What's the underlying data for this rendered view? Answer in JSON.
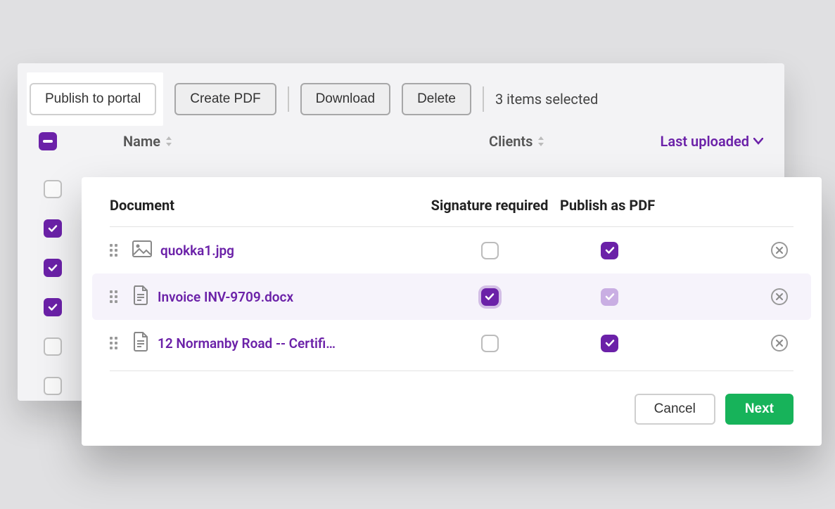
{
  "toolbar": {
    "publish_label": "Publish to portal",
    "create_pdf_label": "Create PDF",
    "download_label": "Download",
    "delete_label": "Delete",
    "selected_text": "3 items selected"
  },
  "headers": {
    "name": "Name",
    "clients": "Clients",
    "last_uploaded": "Last uploaded"
  },
  "bg_rows": [
    {
      "checked": false
    },
    {
      "checked": true
    },
    {
      "checked": true
    },
    {
      "checked": true
    },
    {
      "checked": false
    },
    {
      "checked": false
    }
  ],
  "dialog": {
    "col_document": "Document",
    "col_signature": "Signature required",
    "col_publish_pdf": "Publish as PDF",
    "rows": [
      {
        "name": "quokka1.jpg",
        "type": "image",
        "sig": false,
        "pdf": true,
        "active": false
      },
      {
        "name": "Invoice INV-9709.docx",
        "type": "doc",
        "sig": true,
        "pdf": "disabled",
        "active": true
      },
      {
        "name": "12 Normanby Road -- Certifi…",
        "type": "doc",
        "sig": false,
        "pdf": true,
        "active": false
      }
    ],
    "cancel_label": "Cancel",
    "next_label": "Next"
  }
}
